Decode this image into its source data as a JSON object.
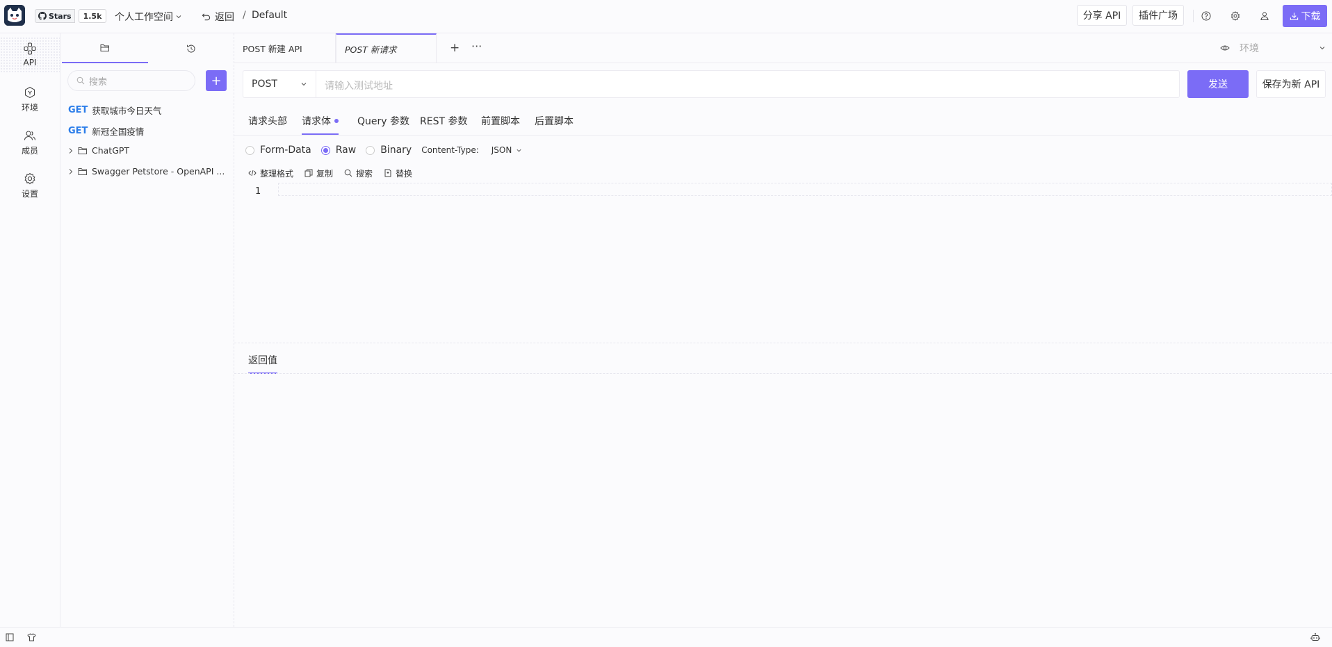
{
  "topbar": {
    "github_stars_label": "Stars",
    "github_stars_count": "1.5k",
    "workspace": "个人工作空间",
    "back": "返回",
    "separator": "/",
    "current_project": "Default",
    "share_api": "分享 API",
    "plugin_market": "插件广场",
    "download": "下载"
  },
  "leftnav": {
    "items": [
      {
        "label": "API",
        "icon": "api-icon"
      },
      {
        "label": "环境",
        "icon": "environment-icon"
      },
      {
        "label": "成员",
        "icon": "members-icon"
      },
      {
        "label": "设置",
        "icon": "settings-icon"
      }
    ]
  },
  "sidebar": {
    "search_placeholder": "搜索",
    "add": "+",
    "items": [
      {
        "method": "GET",
        "name": "获取城市今日天气"
      },
      {
        "method": "GET",
        "name": "新冠全国疫情"
      },
      {
        "name": "ChatGPT",
        "type": "folder"
      },
      {
        "name": "Swagger Petstore - OpenAPI ...",
        "type": "folder"
      }
    ]
  },
  "tabs": [
    {
      "label": "POST 新建 API"
    },
    {
      "label": "POST 新请求"
    }
  ],
  "tabs_plus": "+",
  "tabs_more": "···",
  "env_label": "环境",
  "request": {
    "method": "POST",
    "url_placeholder": "请输入测试地址",
    "send": "发送",
    "save_as_new": "保存为新 API"
  },
  "request_tabs": [
    "请求头部",
    "请求体",
    "Query 参数",
    "REST 参数",
    "前置脚本",
    "后置脚本"
  ],
  "body": {
    "options": [
      "Form-Data",
      "Raw",
      "Binary"
    ],
    "selected": "Raw",
    "content_type_label": "Content-Type:",
    "content_type": "JSON"
  },
  "editor_tools": [
    "整理格式",
    "复制",
    "搜索",
    "替换"
  ],
  "editor_line": "1",
  "response_tab": "返回值",
  "colors": {
    "accent": "#7b6cf6",
    "get_method": "#2b7de9"
  }
}
